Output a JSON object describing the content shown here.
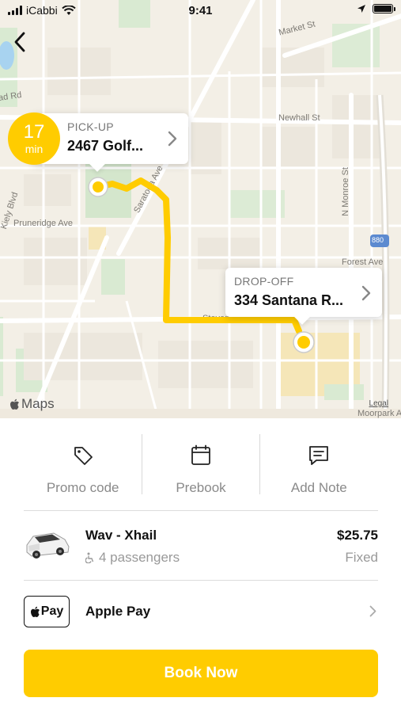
{
  "status_bar": {
    "carrier": "iCabbi",
    "time": "9:41"
  },
  "map": {
    "streets": [
      "Market St",
      "Newhall St",
      "N Monroe St",
      "Pruneridge Ave",
      "Kiely Blvd",
      "Forest Ave",
      "Saratoga Ave",
      "Stevens Creek Blvd",
      "Moorpark Ave",
      "ad Rd",
      "880"
    ],
    "attribution": "Maps",
    "legal": "Legal",
    "route_color": "#FFCC00"
  },
  "eta": {
    "value": "17",
    "unit": "min"
  },
  "pickup": {
    "label": "PICK-UP",
    "address": "2467 Golf..."
  },
  "dropoff": {
    "label": "DROP-OFF",
    "address": "334 Santana R..."
  },
  "actions": [
    {
      "icon": "tag-icon",
      "label": "Promo code"
    },
    {
      "icon": "calendar-icon",
      "label": "Prebook"
    },
    {
      "icon": "note-icon",
      "label": "Add Note"
    }
  ],
  "vehicle": {
    "name": "Wav - Xhail",
    "passengers": "4 passengers",
    "price": "$25.75",
    "price_type": "Fixed"
  },
  "payment": {
    "badge": "Pay",
    "method": "Apple Pay"
  },
  "book_button": "Book Now",
  "colors": {
    "accent": "#FFCC00",
    "text": "#111111",
    "muted": "#999999"
  }
}
